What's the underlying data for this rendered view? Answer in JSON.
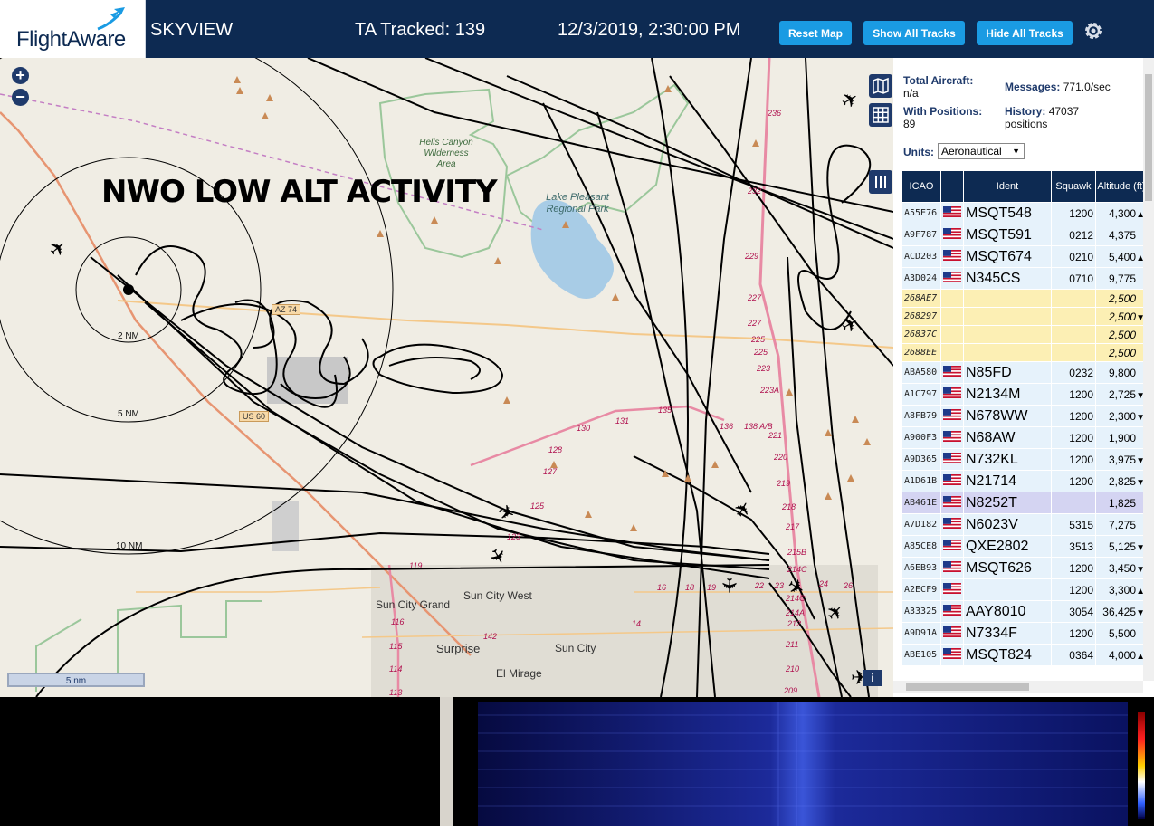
{
  "header": {
    "logo": "FlightAware",
    "app_name": "SKYVIEW",
    "tracked": "TA Tracked: 139",
    "datetime": "12/3/2019, 2:30:00 PM",
    "buttons": {
      "reset": "Reset Map",
      "show": "Show All Tracks",
      "hide": "Hide All Tracks"
    }
  },
  "map": {
    "overlay_title": "NWO LOW ALT ACTIVITY",
    "scale": "5 nm",
    "range_rings": [
      "2 NM",
      "5 NM",
      "10 NM"
    ],
    "places": {
      "hells_canyon": "Hells Canyon Wilderness Area",
      "lake": "Lake Pleasant Regional Park",
      "sun_city_grand": "Sun City Grand",
      "sun_city_west": "Sun City West",
      "surprise": "Surprise",
      "sun_city": "Sun City",
      "el_mirage": "El Mirage"
    },
    "roads": {
      "az74": "AZ 74",
      "us60": "US 60"
    },
    "exits": [
      "236",
      "232",
      "229",
      "227",
      "227",
      "225",
      "225",
      "223",
      "223A",
      "221",
      "220",
      "219",
      "218",
      "217",
      "215B",
      "214C",
      "214C",
      "214A",
      "212",
      "211",
      "210",
      "209",
      "131",
      "135",
      "136",
      "138 A/B",
      "130",
      "128",
      "127",
      "125",
      "123",
      "119",
      "116",
      "115",
      "114",
      "113",
      "142",
      "14",
      "16",
      "18",
      "19",
      "22",
      "23",
      "24",
      "26"
    ]
  },
  "panel": {
    "total_label": "Total Aircraft:",
    "total_value": "n/a",
    "messages_label": "Messages:",
    "messages_value": "771.0/sec",
    "positions_label": "With Positions:",
    "positions_value": "89",
    "history_label": "History:",
    "history_value": "47037 positions",
    "units_label": "Units:",
    "units_value": "Aeronautical",
    "columns": [
      "ICAO",
      "",
      "Ident",
      "Squawk",
      "Altitude (ft)"
    ],
    "rows": [
      {
        "icao": "A55E76",
        "ident": "MSQT548",
        "squawk": "1200",
        "alt": "4,300",
        "trend": "▲",
        "style": "normal"
      },
      {
        "icao": "A9F787",
        "ident": "MSQT591",
        "squawk": "0212",
        "alt": "4,375",
        "trend": "",
        "style": "normal"
      },
      {
        "icao": "ACD203",
        "ident": "MSQT674",
        "squawk": "0210",
        "alt": "5,400",
        "trend": "▲",
        "style": "normal"
      },
      {
        "icao": "A3D024",
        "ident": "N345CS",
        "squawk": "0710",
        "alt": "9,775",
        "trend": "",
        "style": "normal"
      },
      {
        "icao": "268AE7",
        "ident": "",
        "squawk": "",
        "alt": "2,500",
        "trend": "",
        "style": "yellow"
      },
      {
        "icao": "268297",
        "ident": "",
        "squawk": "",
        "alt": "2,500",
        "trend": "▼",
        "style": "yellow"
      },
      {
        "icao": "26837C",
        "ident": "",
        "squawk": "",
        "alt": "2,500",
        "trend": "",
        "style": "yellow"
      },
      {
        "icao": "2688EE",
        "ident": "",
        "squawk": "",
        "alt": "2,500",
        "trend": "",
        "style": "yellow"
      },
      {
        "icao": "ABA580",
        "ident": "N85FD",
        "squawk": "0232",
        "alt": "9,800",
        "trend": "",
        "style": "normal"
      },
      {
        "icao": "A1C797",
        "ident": "N2134M",
        "squawk": "1200",
        "alt": "2,725",
        "trend": "▼",
        "style": "normal"
      },
      {
        "icao": "A8FB79",
        "ident": "N678WW",
        "squawk": "1200",
        "alt": "2,300",
        "trend": "▼",
        "style": "normal"
      },
      {
        "icao": "A900F3",
        "ident": "N68AW",
        "squawk": "1200",
        "alt": "1,900",
        "trend": "",
        "style": "normal"
      },
      {
        "icao": "A9D365",
        "ident": "N732KL",
        "squawk": "1200",
        "alt": "3,975",
        "trend": "▼",
        "style": "normal"
      },
      {
        "icao": "A1D61B",
        "ident": "N21714",
        "squawk": "1200",
        "alt": "2,825",
        "trend": "▼",
        "style": "normal"
      },
      {
        "icao": "AB461E",
        "ident": "N8252T",
        "squawk": "",
        "alt": "1,825",
        "trend": "",
        "style": "sel"
      },
      {
        "icao": "A7D182",
        "ident": "N6023V",
        "squawk": "5315",
        "alt": "7,275",
        "trend": "",
        "style": "normal"
      },
      {
        "icao": "A85CE8",
        "ident": "QXE2802",
        "squawk": "3513",
        "alt": "5,125",
        "trend": "▼",
        "style": "normal"
      },
      {
        "icao": "A6EB93",
        "ident": "MSQT626",
        "squawk": "1200",
        "alt": "3,450",
        "trend": "▼",
        "style": "normal"
      },
      {
        "icao": "A2ECF9",
        "ident": "",
        "squawk": "1200",
        "alt": "3,300",
        "trend": "▲",
        "style": "normal"
      },
      {
        "icao": "A33325",
        "ident": "AAY8010",
        "squawk": "3054",
        "alt": "36,425",
        "trend": "▼",
        "style": "normal"
      },
      {
        "icao": "A9D91A",
        "ident": "N7334F",
        "squawk": "1200",
        "alt": "5,500",
        "trend": "",
        "style": "normal"
      },
      {
        "icao": "ABE105",
        "ident": "MSQT824",
        "squawk": "0364",
        "alt": "4,000",
        "trend": "▲",
        "style": "normal"
      }
    ]
  },
  "colors": {
    "header_bg": "#0d2a52",
    "button": "#1a9be3",
    "row_bg": "#e6f2fb",
    "row_yellow": "#fcefb4",
    "row_selected": "#d4d4f2"
  },
  "icons": [
    "flightaware-plane-icon",
    "gear-icon",
    "zoom-in-icon",
    "zoom-out-icon",
    "map-icon",
    "grid-icon",
    "columns-icon",
    "info-icon",
    "aircraft-icon",
    "us-flag-icon"
  ]
}
